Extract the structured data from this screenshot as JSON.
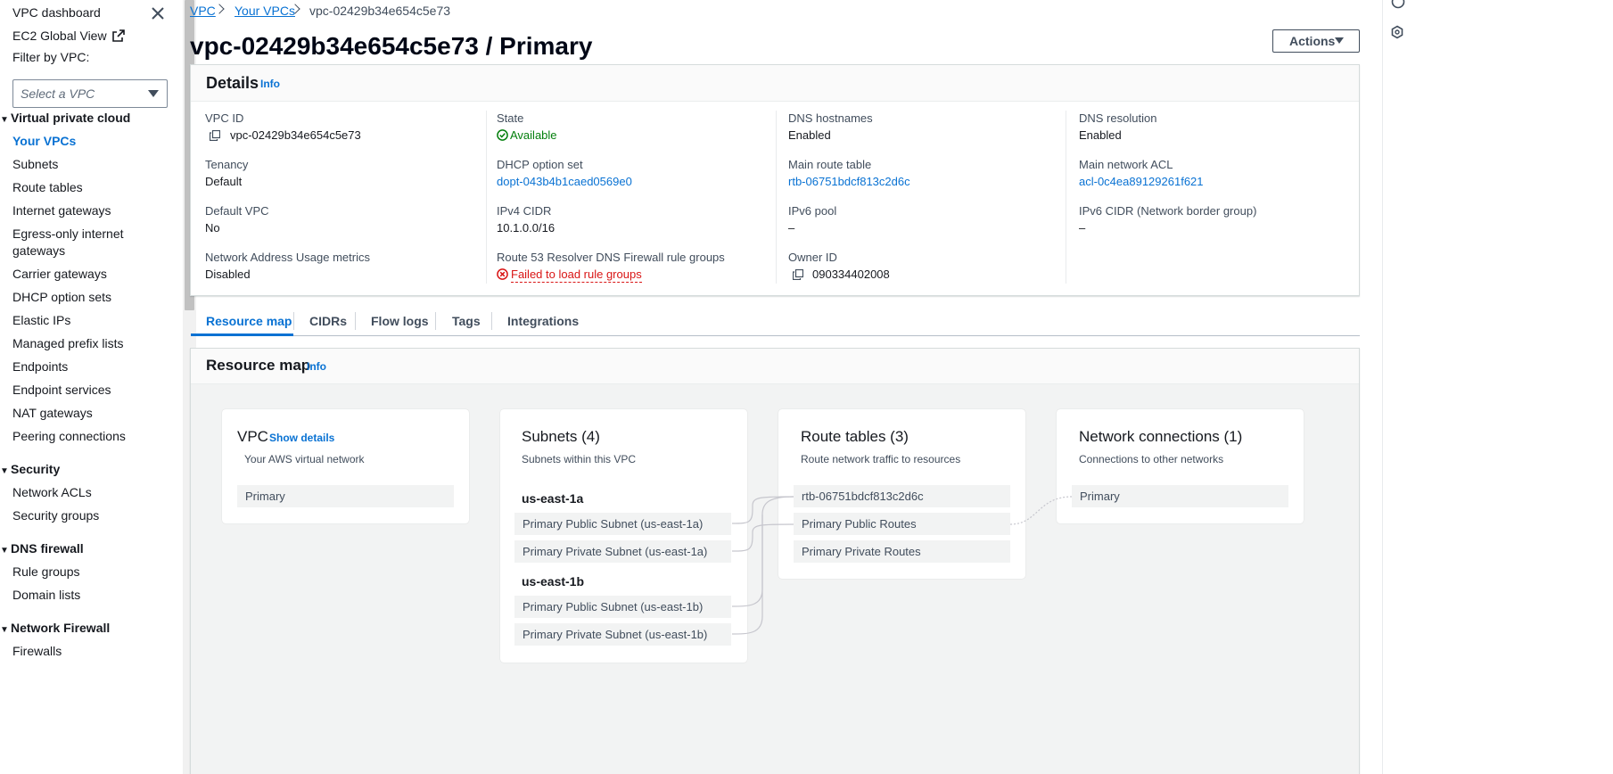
{
  "sidebar": {
    "dashboard": "VPC dashboard",
    "ec2_global_view": "EC2 Global View",
    "filter_label": "Filter by VPC:",
    "filter_placeholder": "Select a VPC",
    "sections": {
      "virtual_private_cloud": "Virtual private cloud",
      "security": "Security",
      "dns_firewall": "DNS firewall",
      "network_firewall": "Network Firewall"
    },
    "items": {
      "your_vpcs": "Your VPCs",
      "subnets": "Subnets",
      "route_tables": "Route tables",
      "internet_gateways": "Internet gateways",
      "egress_only_1": "Egress-only internet",
      "egress_only_2": "gateways",
      "carrier_gateways": "Carrier gateways",
      "dhcp_option_sets": "DHCP option sets",
      "elastic_ips": "Elastic IPs",
      "managed_prefix_lists": "Managed prefix lists",
      "endpoints": "Endpoints",
      "endpoint_services": "Endpoint services",
      "nat_gateways": "NAT gateways",
      "peering_connections": "Peering connections",
      "network_acls": "Network ACLs",
      "security_groups": "Security groups",
      "rule_groups": "Rule groups",
      "domain_lists": "Domain lists",
      "firewalls": "Firewalls"
    }
  },
  "breadcrumb": {
    "vpc": "VPC",
    "your_vpcs": "Your VPCs",
    "current": "vpc-02429b34e654c5e73"
  },
  "page_title": "vpc-02429b34e654c5e73 / Primary",
  "actions_label": "Actions",
  "details": {
    "title": "Details",
    "info": "Info",
    "vpc_id_label": "VPC ID",
    "vpc_id": "vpc-02429b34e654c5e73",
    "state_label": "State",
    "state": "Available",
    "dns_hostnames_label": "DNS hostnames",
    "dns_hostnames": "Enabled",
    "dns_resolution_label": "DNS resolution",
    "dns_resolution": "Enabled",
    "tenancy_label": "Tenancy",
    "tenancy": "Default",
    "dhcp_label": "DHCP option set",
    "dhcp": "dopt-043b4b1caed0569e0",
    "main_route_table_label": "Main route table",
    "main_route_table": "rtb-06751bdcf813c2d6c",
    "main_acl_label": "Main network ACL",
    "main_acl": "acl-0c4ea89129261f621",
    "default_vpc_label": "Default VPC",
    "default_vpc": "No",
    "ipv4_cidr_label": "IPv4 CIDR",
    "ipv4_cidr": "10.1.0.0/16",
    "ipv6_pool_label": "IPv6 pool",
    "ipv6_pool": "–",
    "ipv6_cidr_label": "IPv6 CIDR (Network border group)",
    "ipv6_cidr": "–",
    "nau_label": "Network Address Usage metrics",
    "nau": "Disabled",
    "r53_label": "Route 53 Resolver DNS Firewall rule groups",
    "r53": "Failed to load rule groups",
    "owner_label": "Owner ID",
    "owner": "090334402008"
  },
  "tabs": {
    "resource_map": "Resource map",
    "cidrs": "CIDRs",
    "flow_logs": "Flow logs",
    "tags": "Tags",
    "integrations": "Integrations"
  },
  "resource_map": {
    "title": "Resource map",
    "info": "Info",
    "vpc": {
      "title": "VPC",
      "show_details": "Show details",
      "subtitle": "Your AWS virtual network",
      "item": "Primary"
    },
    "subnets": {
      "title": "Subnets (4)",
      "subtitle": "Subnets within this VPC",
      "az1": "us-east-1a",
      "az1_items": [
        "Primary Public Subnet (us-east-1a)",
        "Primary Private Subnet (us-east-1a)"
      ],
      "az2": "us-east-1b",
      "az2_items": [
        "Primary Public Subnet (us-east-1b)",
        "Primary Private Subnet (us-east-1b)"
      ]
    },
    "route_tables": {
      "title": "Route tables (3)",
      "subtitle": "Route network traffic to resources",
      "items": [
        "rtb-06751bdcf813c2d6c",
        "Primary Public Routes",
        "Primary Private Routes"
      ]
    },
    "network_connections": {
      "title": "Network connections (1)",
      "subtitle": "Connections to other networks",
      "item": "Primary"
    }
  },
  "colors": {
    "link": "#0972d3",
    "success": "#037f0c",
    "error": "#d91515"
  }
}
